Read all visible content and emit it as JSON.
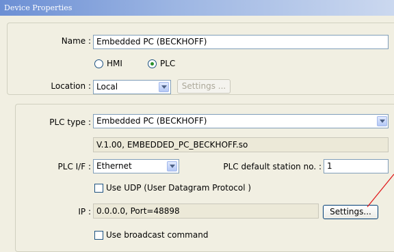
{
  "window": {
    "title": "Device Properties"
  },
  "name": {
    "label": "Name :",
    "value": "Embedded PC (BECKHOFF)"
  },
  "type_radio": {
    "hmi_label": "HMI",
    "plc_label": "PLC",
    "selected": "PLC"
  },
  "location": {
    "label": "Location :",
    "value": "Local",
    "settings_label": "Settings ..."
  },
  "plc_type": {
    "label": "PLC type :",
    "value": "Embedded PC (BECKHOFF)",
    "version": "V.1.00, EMBEDDED_PC_BECKHOFF.so"
  },
  "plc_if": {
    "label": "PLC I/F :",
    "value": "Ethernet"
  },
  "station": {
    "label": "PLC default station no. :",
    "value": "1"
  },
  "use_udp": {
    "label": "Use UDP (User Datagram Protocol )",
    "checked": false
  },
  "ip": {
    "label": "IP :",
    "value": "0.0.0.0,  Port=48898",
    "settings_label": "Settings..."
  },
  "broadcast": {
    "label": "Use broadcast command",
    "checked": false
  },
  "colors": {
    "title_bar": "#6c8fd4",
    "annotation_line": "#e0191b"
  }
}
